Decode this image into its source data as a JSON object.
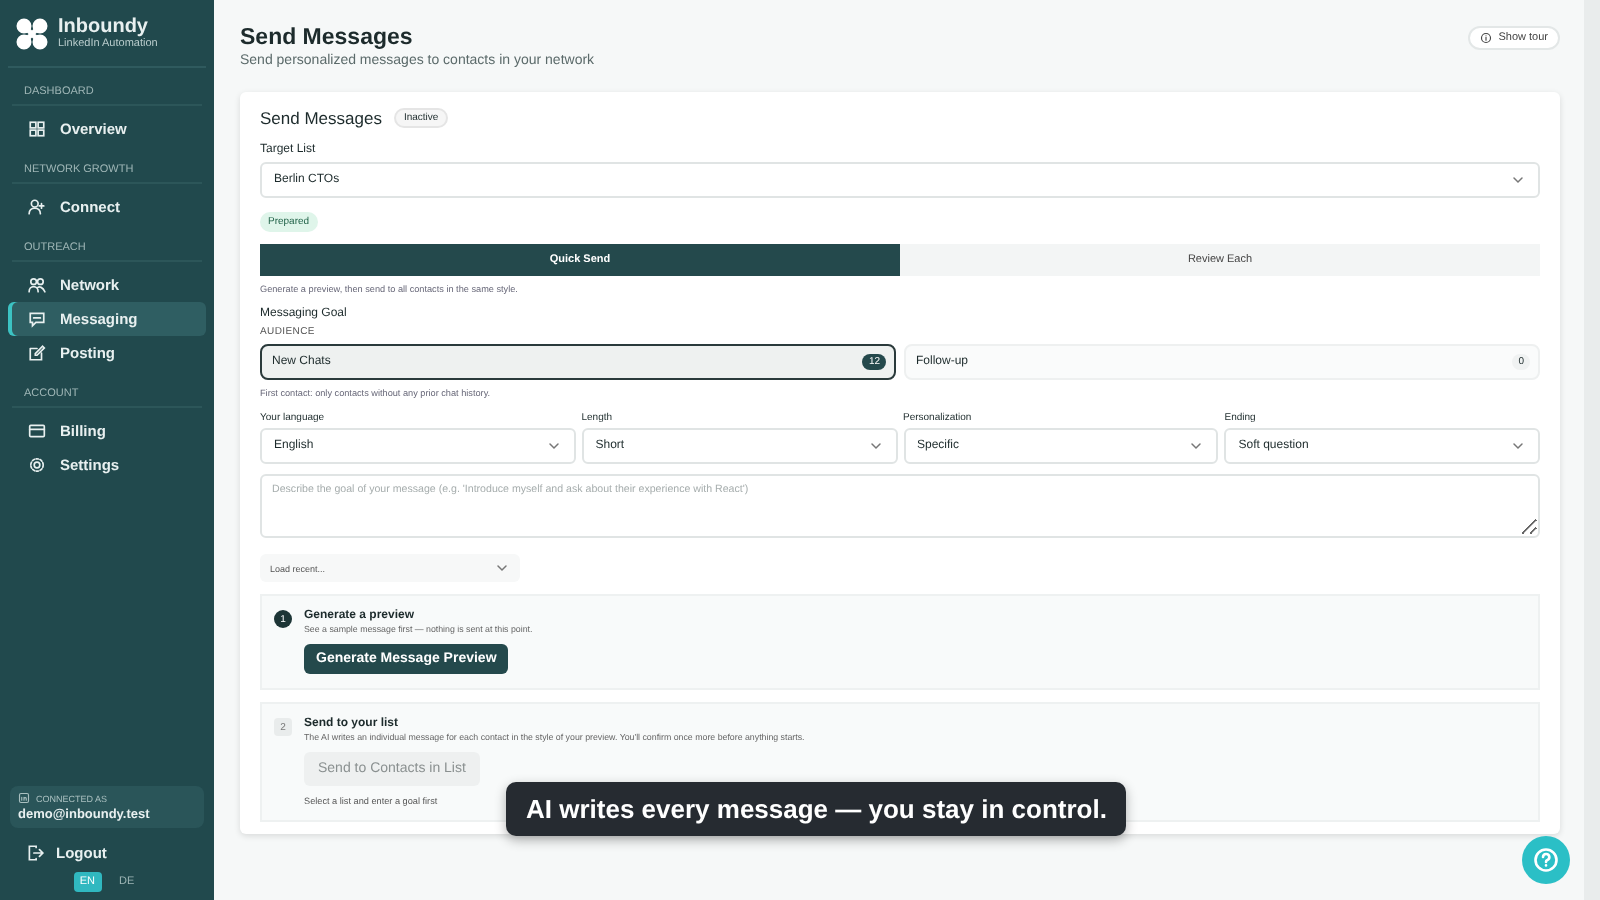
{
  "sidebar": {
    "brand": {
      "name": "Inboundy",
      "tagline": "LinkedIn Automation"
    },
    "sections": [
      {
        "title": "DASHBOARD",
        "items": [
          {
            "label": "Overview",
            "kind": "grid",
            "selected": false
          }
        ]
      },
      {
        "title": "NETWORK GROWTH",
        "items": [
          {
            "label": "Connect",
            "kind": "person",
            "selected": false
          }
        ]
      },
      {
        "title": "OUTREACH",
        "items": [
          {
            "label": "Network",
            "kind": "people",
            "selected": false
          },
          {
            "label": "Messaging",
            "kind": "chat",
            "selected": true
          },
          {
            "label": "Posting",
            "kind": "edit",
            "selected": false
          }
        ]
      },
      {
        "title": "ACCOUNT",
        "items": [
          {
            "label": "Billing",
            "kind": "card",
            "selected": false
          },
          {
            "label": "Settings",
            "kind": "gear",
            "selected": false
          }
        ]
      }
    ],
    "account": {
      "label": "CONNECTED AS",
      "email": "demo@inboundy.test"
    },
    "logout": "Logout",
    "languages": [
      {
        "label": "EN",
        "selected": true
      },
      {
        "label": "DE",
        "selected": false
      }
    ]
  },
  "header": {
    "title": "Send Messages",
    "subtitle": "Send personalized messages to contacts in your network",
    "tour_button": "Show tour"
  },
  "card": {
    "title": "Send Messages",
    "status": "Inactive",
    "target_list": {
      "label": "Target List",
      "value": "Berlin CTOs"
    },
    "list_status": "Prepared",
    "modes": [
      {
        "label": "Quick Send",
        "selected": true
      },
      {
        "label": "Review Each",
        "selected": false
      }
    ],
    "mode_hint": "Generate a preview, then send to all contacts in the same style.",
    "goal": {
      "title": "Messaging Goal",
      "audience_label": "AUDIENCE",
      "audiences": [
        {
          "label": "New Chats",
          "count": "12",
          "selected": true
        },
        {
          "label": "Follow-up",
          "count": "0",
          "selected": false
        }
      ],
      "audience_hint": "First contact: only contacts without any prior chat history.",
      "options": [
        {
          "label": "Your language",
          "value": "English"
        },
        {
          "label": "Length",
          "value": "Short"
        },
        {
          "label": "Personalization",
          "value": "Specific"
        },
        {
          "label": "Ending",
          "value": "Soft question"
        }
      ],
      "goal_field": {
        "placeholder": "Describe the goal of your message (e.g. 'Introduce myself and ask about their experience with React')"
      },
      "load_recent": "Load recent..."
    },
    "steps": [
      {
        "number": "1",
        "title": "Generate a preview",
        "description": "See a sample message first — nothing is sent at this point.",
        "button": "Generate Message Preview",
        "disabled": false
      },
      {
        "number": "2",
        "title": "Send to your list",
        "description": "The AI writes an individual message for each contact in the style of your preview. You'll confirm once more before anything starts.",
        "button": "Send to Contacts in List",
        "disabled": true,
        "note": "Select a list and enter a goal first"
      }
    ]
  },
  "toast": "AI writes every message — you stay in control."
}
